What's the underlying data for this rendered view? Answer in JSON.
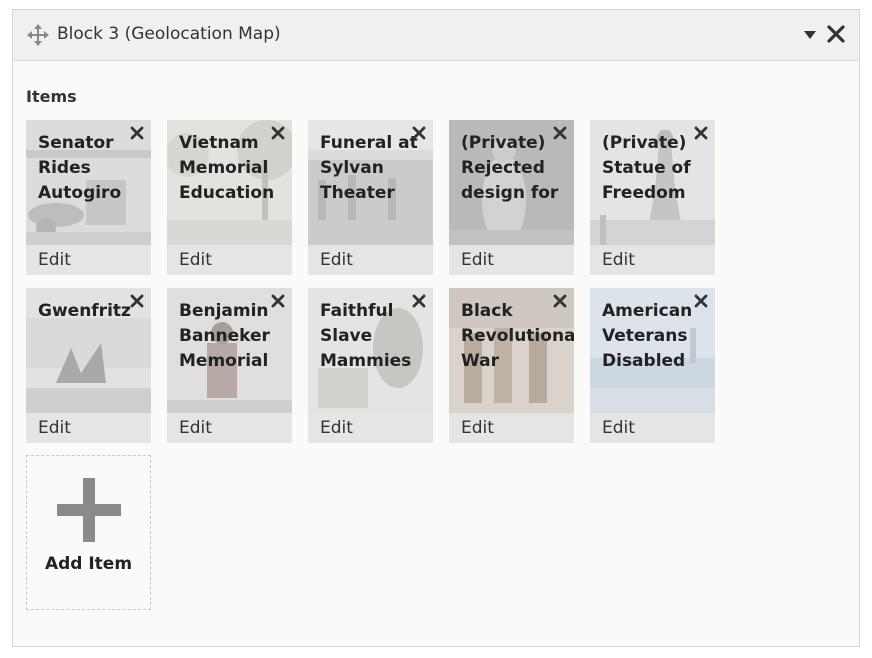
{
  "block": {
    "title": "Block 3 (Geolocation Map)",
    "move_icon": "move-arrows-icon",
    "collapse_icon": "caret-down-icon",
    "close_icon": "close-icon"
  },
  "items_label": "Items",
  "items": [
    {
      "title": "Senator\nRides\nAutogiro",
      "edit": "Edit",
      "thumb": "photo-biplane"
    },
    {
      "title": "Vietnam\nMemorial\nEducation",
      "edit": "Edit",
      "thumb": "photo-trees"
    },
    {
      "title": "Funeral at\nSylvan\nTheater",
      "edit": "Edit",
      "thumb": "photo-crowd"
    },
    {
      "title": "(Private)\nRejected\ndesign for",
      "edit": "Edit",
      "thumb": "photo-statue-dark"
    },
    {
      "title": "(Private)\nStatue of\nFreedom",
      "edit": "Edit",
      "thumb": "photo-capitol-statue"
    },
    {
      "title": "Gwenfritz",
      "edit": "Edit",
      "thumb": "photo-sculpture"
    },
    {
      "title": "Benjamin\nBanneker\nMemorial",
      "edit": "Edit",
      "thumb": "photo-figure"
    },
    {
      "title": "Faithful\nSlave\nMammies of",
      "edit": "Edit",
      "thumb": "photo-drawing"
    },
    {
      "title": "Black\nRevolutionar\nWar Patriots",
      "edit": "Edit",
      "thumb": "photo-painting"
    },
    {
      "title": "American\nVeterans\nDisabled for",
      "edit": "Edit",
      "thumb": "photo-pool"
    }
  ],
  "add_item": {
    "label": "Add Item"
  },
  "colors": {
    "panel": "#fafaf8",
    "header": "#f0f0ef",
    "tile": "#e5e5e4",
    "icon": "#333333",
    "plus": "#8a8a8a"
  }
}
